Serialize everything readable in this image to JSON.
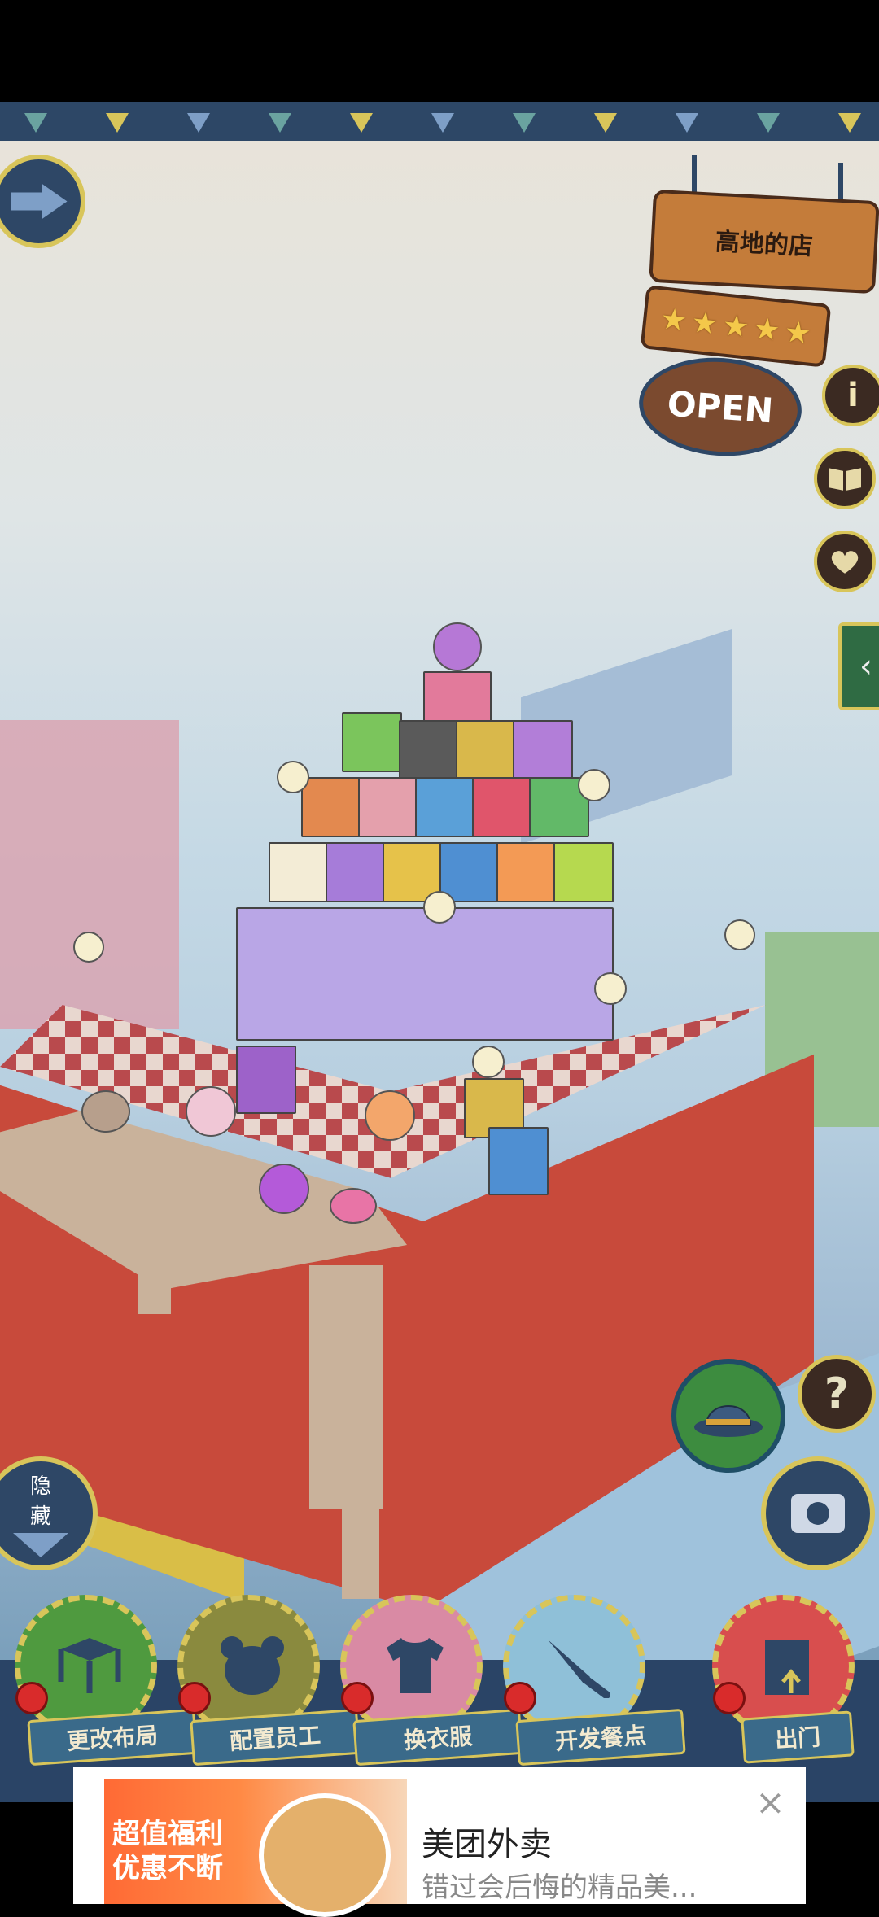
{
  "shop": {
    "name": "高地的店",
    "rating_stars": 5,
    "status": "OPEN",
    "star_glyph": "★"
  },
  "side_buttons": {
    "info": "i",
    "help": "?"
  },
  "hide_button": {
    "label_top": "隐",
    "label_bottom": "藏"
  },
  "actions": [
    {
      "label": "更改布局",
      "icon": "table-icon"
    },
    {
      "label": "配置员工",
      "icon": "bear-icon"
    },
    {
      "label": "换衣服",
      "icon": "shirt-icon"
    },
    {
      "label": "开发餐点",
      "icon": "knife-icon"
    },
    {
      "label": "出门",
      "icon": "door-icon"
    }
  ],
  "ad": {
    "title": "美团外卖",
    "description": "错过会后悔的精品美...",
    "promo_line1": "超值福利",
    "promo_line2": "优惠不断",
    "close": "×"
  },
  "colors": {
    "frame_blue": "#2e4766",
    "frame_gold": "#d8c55a",
    "wood": "#c47c3a",
    "pin_red": "#d92b2b"
  }
}
